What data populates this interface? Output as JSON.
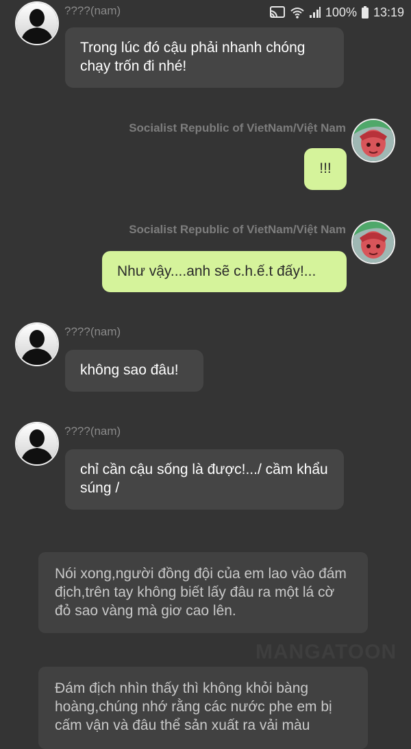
{
  "status_bar": {
    "battery": "100%",
    "time": "13:19",
    "icons": [
      "cast-icon",
      "wifi-icon",
      "signal-icon",
      "battery-icon"
    ]
  },
  "messages": [
    {
      "side": "left",
      "sender": "????(nam)",
      "text": "Trong lúc đó cậu phải nhanh chóng chạy trốn đi nhé!"
    },
    {
      "side": "right",
      "sender": "Socialist Republic of VietNam/Việt  Nam",
      "text": "!!!"
    },
    {
      "side": "right",
      "sender": "Socialist Republic of VietNam/Việt  Nam",
      "text": "Như vậy....anh sẽ c.h.ế.t đấy!..."
    },
    {
      "side": "left",
      "sender": "????(nam)",
      "text": "không sao đâu!"
    },
    {
      "side": "left",
      "sender": "????(nam)",
      "text": "chỉ cần cậu sống là được!.../ cầm khẩu súng /"
    }
  ],
  "narrations": [
    "Nói xong,người đồng đội của em lao vào đám địch,trên tay không biết lấy đâu ra một lá cờ đỏ sao vàng mà giơ cao lên.",
    "Đám địch nhìn thấy thì không khỏi bàng hoàng,chúng nhớ rằng các nước phe em bị cấm vận và đâu thể sản xuất ra vải màu"
  ],
  "watermark": "MANGATOON",
  "colors": {
    "background": "#343434",
    "left_bubble": "#454545",
    "right_bubble": "#d5f39b",
    "narration_bg": "#414141"
  }
}
